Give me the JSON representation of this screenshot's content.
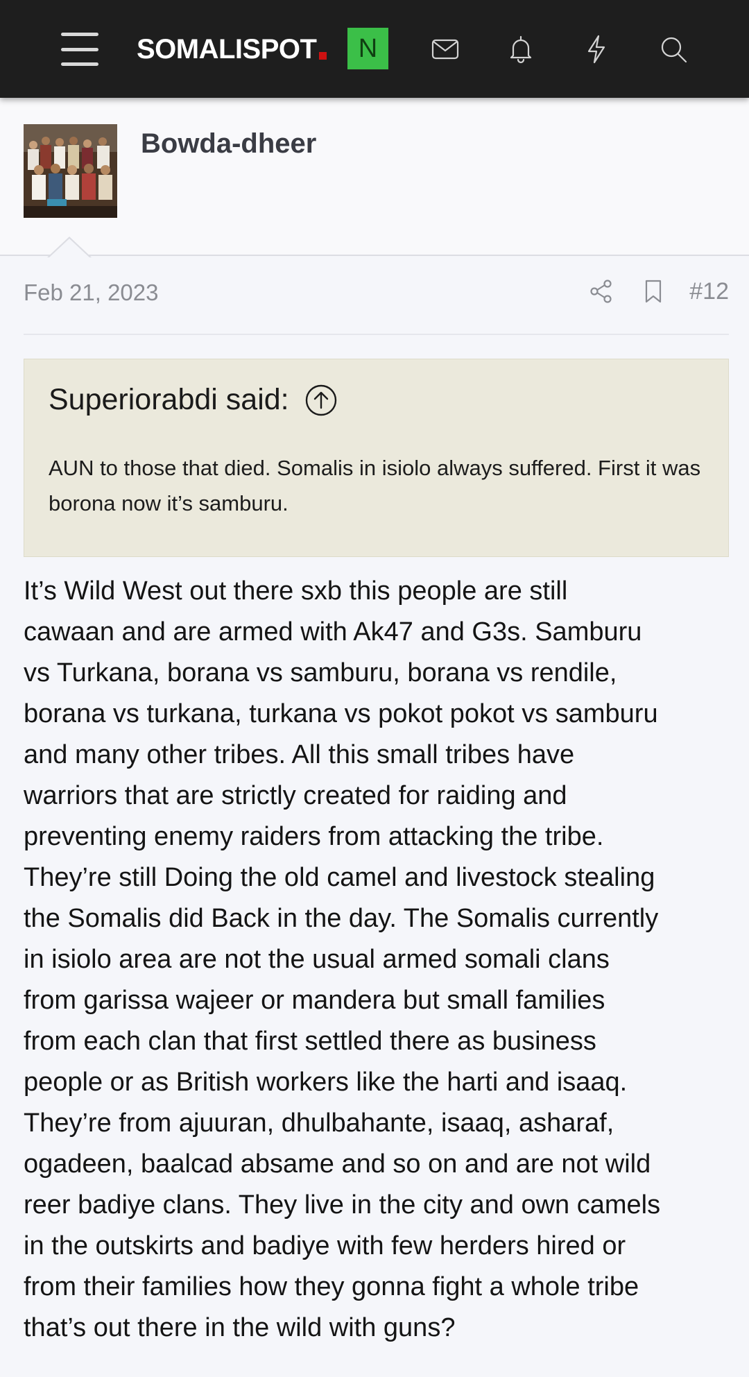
{
  "header": {
    "logo_text": "SOMALISPOT",
    "new_badge": "N",
    "icons": [
      "menu-icon",
      "envelope-icon",
      "bell-icon",
      "lightning-icon",
      "search-icon"
    ]
  },
  "author": {
    "username": "Bowda-dheer"
  },
  "post": {
    "date": "Feb 21, 2023",
    "number": "#12",
    "quote": {
      "author_line": "Superiorabdi said:",
      "text": "AUN to those that died. Somalis in isiolo always suffered. First it was borona now it’s samburu."
    },
    "lines": [
      "It’s Wild West out there sxb this people are still",
      "cawaan and are armed with Ak47 and G3s. Samburu",
      "vs Turkana, borana vs samburu, borana vs rendile,",
      "borana vs turkana, turkana vs pokot pokot vs samburu",
      "and many other tribes. All this small tribes have",
      "warriors that are strictly created for raiding and",
      "preventing enemy raiders from attacking the tribe.",
      "They’re still Doing the old camel and livestock stealing",
      "the Somalis did Back in the day. The Somalis currently",
      "in isiolo area are not the usual armed somali clans",
      "from garissa wajeer or mandera but small families",
      "from each clan that first settled there as business",
      "people or as British workers like the harti and isaaq.",
      "They’re from ajuuran, dhulbahante, isaaq, asharaf,",
      "ogadeen, baalcad absame and so on and are not wild",
      "reer badiye clans. They live in the city and own camels",
      "in the outskirts and badiye with few herders hired or",
      "from their families how they gonna fight a whole tribe",
      "that’s out there in the wild with guns?"
    ]
  },
  "colors": {
    "topbar": "#1e1e1e",
    "logo_dot": "#cc1111",
    "badge_bg": "#3bbf48",
    "quote_bg": "#ebe9dc",
    "page_bg": "#f5f6fa",
    "meta_text": "#8a8c92"
  }
}
